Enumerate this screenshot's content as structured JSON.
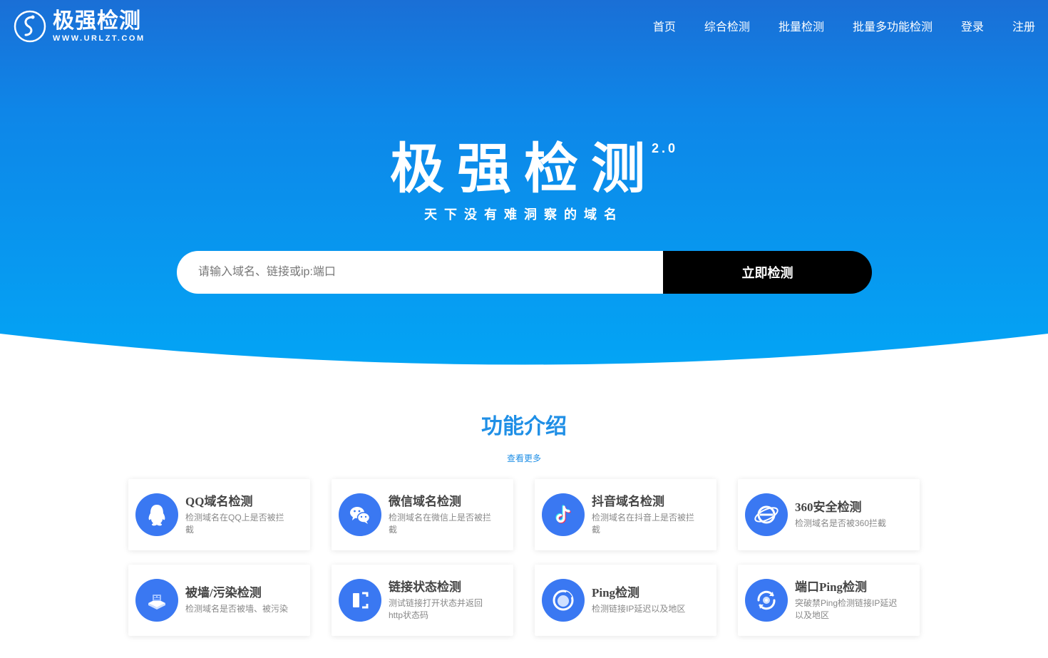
{
  "nav": {
    "logo": {
      "name": "极强检测",
      "url": "WWW.URLZT.COM"
    },
    "items": [
      {
        "label": "首页"
      },
      {
        "label": "综合检测"
      },
      {
        "label": "批量检测"
      },
      {
        "label": "批量多功能检测"
      },
      {
        "label": "登录"
      },
      {
        "label": "注册"
      }
    ]
  },
  "hero": {
    "title": "极强检测",
    "version": "2.0",
    "slogan": "天下没有难洞察的域名",
    "search": {
      "placeholder": "请输入域名、链接或ip:端口",
      "value": "",
      "button": "立即检测"
    }
  },
  "features": {
    "title": "功能介绍",
    "more": "查看更多",
    "cards": [
      {
        "title": "QQ域名检测",
        "desc": "检测域名在QQ上是否被拦截",
        "icon": "qq-icon"
      },
      {
        "title": "微信域名检测",
        "desc": "检测域名在微信上是否被拦截",
        "icon": "wechat-icon"
      },
      {
        "title": "抖音域名检测",
        "desc": "检测域名在抖音上是否被拦截",
        "icon": "tiktok-icon"
      },
      {
        "title": "360安全检测",
        "desc": "检测域名是否被360拦截",
        "icon": "browser-360-icon"
      },
      {
        "title": "被墙/污染检测",
        "desc": "检测域名是否被墙、被污染",
        "icon": "firewall-icon"
      },
      {
        "title": "链接状态检测",
        "desc": "测试链接打开状态并返回http状态码",
        "icon": "link-status-icon"
      },
      {
        "title": "Ping检测",
        "desc": "检测链接IP延迟以及地区",
        "icon": "ping-icon"
      },
      {
        "title": "端口Ping检测",
        "desc": "突破禁Ping检测链接IP延迟以及地区",
        "icon": "port-ping-icon"
      }
    ]
  },
  "colors": {
    "primary": "#1f8fe6",
    "icon_bg": "#3a78f2",
    "button_bg": "#000000"
  }
}
